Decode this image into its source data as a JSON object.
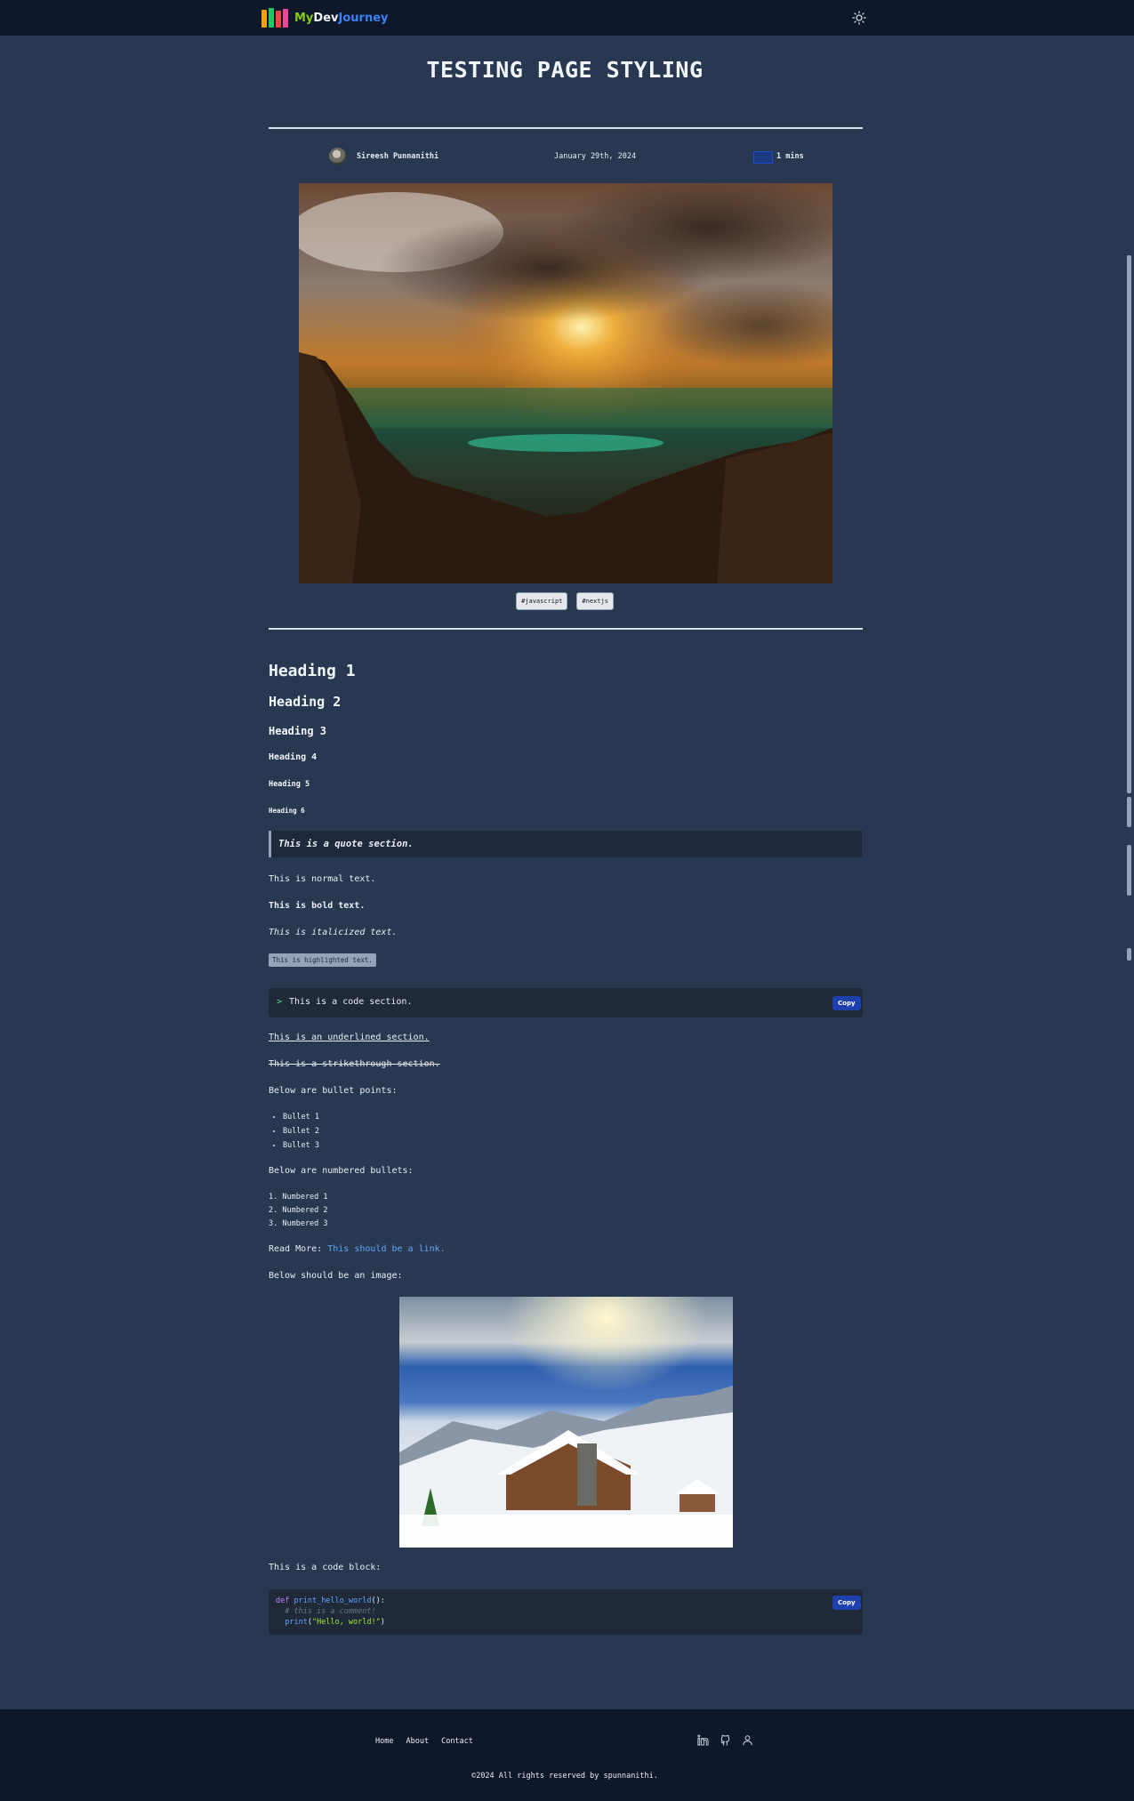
{
  "header": {
    "logo_part1": "My",
    "logo_part2": "Dev",
    "logo_part3": "Journey",
    "theme_icon": "sun-icon"
  },
  "post": {
    "title": "TESTING PAGE STYLING",
    "author": "Sireesh Punnanithi",
    "date": "January 29th, 2024",
    "read_time": "1 mins",
    "tags": [
      "#javascript",
      "#nextjs"
    ]
  },
  "content": {
    "h1": "Heading 1",
    "h2": "Heading 2",
    "h3": "Heading 3",
    "h4": "Heading 4",
    "h5": "Heading 5",
    "h6": "Heading 6",
    "quote": "This is a quote section.",
    "normal": "This is normal text.",
    "bold": "This is bold text.",
    "italic": "This is italicized text.",
    "highlight": "This is highlighted text.",
    "code_prompt": ">",
    "code_inline": "This is a code section.",
    "copy_label": "Copy",
    "underlined": "This is an underlined section.",
    "strikethrough": "This is a strikethrough section.",
    "bullets_intro": "Below are bullet points:",
    "bullets": [
      "Bullet 1",
      "Bullet 2",
      "Bullet 3"
    ],
    "numbers_intro": "Below are numbered bullets:",
    "numbered": [
      "1. Numbered 1",
      "2. Numbered 2",
      "3. Numbered 3"
    ],
    "read_more_label": "Read More:",
    "read_more_link": "This should be a link.",
    "image_intro": "Below should be an image:",
    "code_block_intro": "This is a code block:",
    "code_block": {
      "l1_kw": "def",
      "l1_fn": "print_hello_world",
      "l1_rest": "():",
      "l2_comment": "  # this is a comment!",
      "l3_fn": "  print",
      "l3_p1": "(",
      "l3_str": "\"Hello, world!\"",
      "l3_p2": ")"
    }
  },
  "footer": {
    "nav": [
      "Home",
      "About",
      "Contact"
    ],
    "icons": [
      "linkedin-icon",
      "github-icon",
      "user-icon"
    ],
    "copyright": "©2024 All rights reserved by spunnanithi."
  },
  "colors": {
    "background": "#283850",
    "navbar": "#0f172a",
    "accent_blue": "#1e40af",
    "link": "#60a5fa"
  }
}
